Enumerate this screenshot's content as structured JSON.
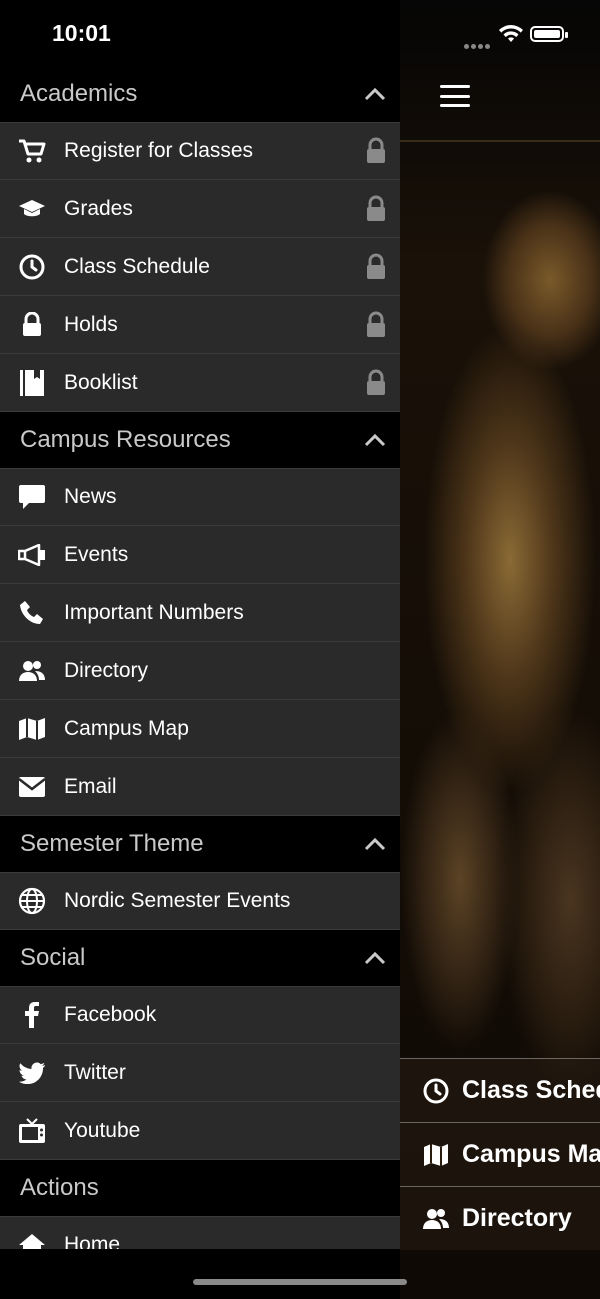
{
  "status_bar": {
    "time": "10:01"
  },
  "drawer": {
    "sections": [
      {
        "title": "Academics",
        "items": [
          {
            "label": "Register for Classes",
            "icon": "cart-icon",
            "locked": true
          },
          {
            "label": "Grades",
            "icon": "graduation-cap-icon",
            "locked": true
          },
          {
            "label": "Class Schedule",
            "icon": "clock-icon",
            "locked": true
          },
          {
            "label": "Holds",
            "icon": "lock-icon",
            "locked": true
          },
          {
            "label": "Booklist",
            "icon": "book-icon",
            "locked": true
          }
        ]
      },
      {
        "title": "Campus Resources",
        "items": [
          {
            "label": "News",
            "icon": "speech-bubble-icon"
          },
          {
            "label": "Events",
            "icon": "megaphone-icon"
          },
          {
            "label": "Important Numbers",
            "icon": "phone-icon"
          },
          {
            "label": "Directory",
            "icon": "users-icon"
          },
          {
            "label": "Campus Map",
            "icon": "map-icon"
          },
          {
            "label": "Email",
            "icon": "envelope-icon"
          }
        ]
      },
      {
        "title": "Semester Theme",
        "items": [
          {
            "label": "Nordic Semester Events",
            "icon": "globe-icon"
          }
        ]
      },
      {
        "title": "Social",
        "items": [
          {
            "label": "Facebook",
            "icon": "facebook-icon"
          },
          {
            "label": "Twitter",
            "icon": "twitter-icon"
          },
          {
            "label": "Youtube",
            "icon": "tv-icon"
          }
        ]
      },
      {
        "title": "Actions",
        "items": [
          {
            "label": "Home",
            "icon": "home-icon"
          }
        ]
      }
    ]
  },
  "quick_links": [
    {
      "label": "Class Schedule",
      "icon": "clock-icon"
    },
    {
      "label": "Campus Map",
      "icon": "map-icon"
    },
    {
      "label": "Directory",
      "icon": "users-icon"
    }
  ],
  "colors": {
    "item_bg": "#2a2a2a",
    "section_bg": "#000000",
    "text": "#ffffff",
    "section_text": "#c9c9c9",
    "lock": "#8a8a8a"
  }
}
